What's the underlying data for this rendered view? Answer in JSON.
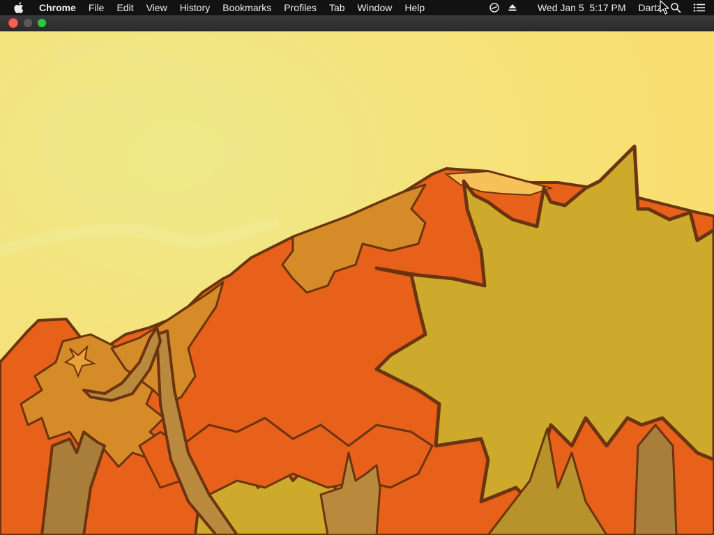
{
  "menubar": {
    "app_name": "Chrome",
    "menus": [
      {
        "label": "File"
      },
      {
        "label": "Edit"
      },
      {
        "label": "View"
      },
      {
        "label": "History"
      },
      {
        "label": "Bookmarks"
      },
      {
        "label": "Profiles"
      },
      {
        "label": "Tab"
      },
      {
        "label": "Window"
      },
      {
        "label": "Help"
      }
    ],
    "status": {
      "clock": "Wed Jan 5  5:17 PM",
      "user": "Dartz",
      "icons": [
        "screen-recording-icon",
        "eject-icon",
        "spotlight-search-icon",
        "notification-center-icon"
      ]
    }
  },
  "window": {
    "controls": [
      "close-button",
      "minimize-button",
      "zoom-button"
    ]
  },
  "content": {
    "description": "cartoon autumn tree foliage artwork",
    "colors": {
      "sky": "#f6e27a",
      "orange": "#e8611a",
      "yellow_ochre": "#cdaa2c",
      "dark_ochre": "#d58c28",
      "outline": "#6b3410",
      "trunk": "#a87e3a"
    }
  }
}
